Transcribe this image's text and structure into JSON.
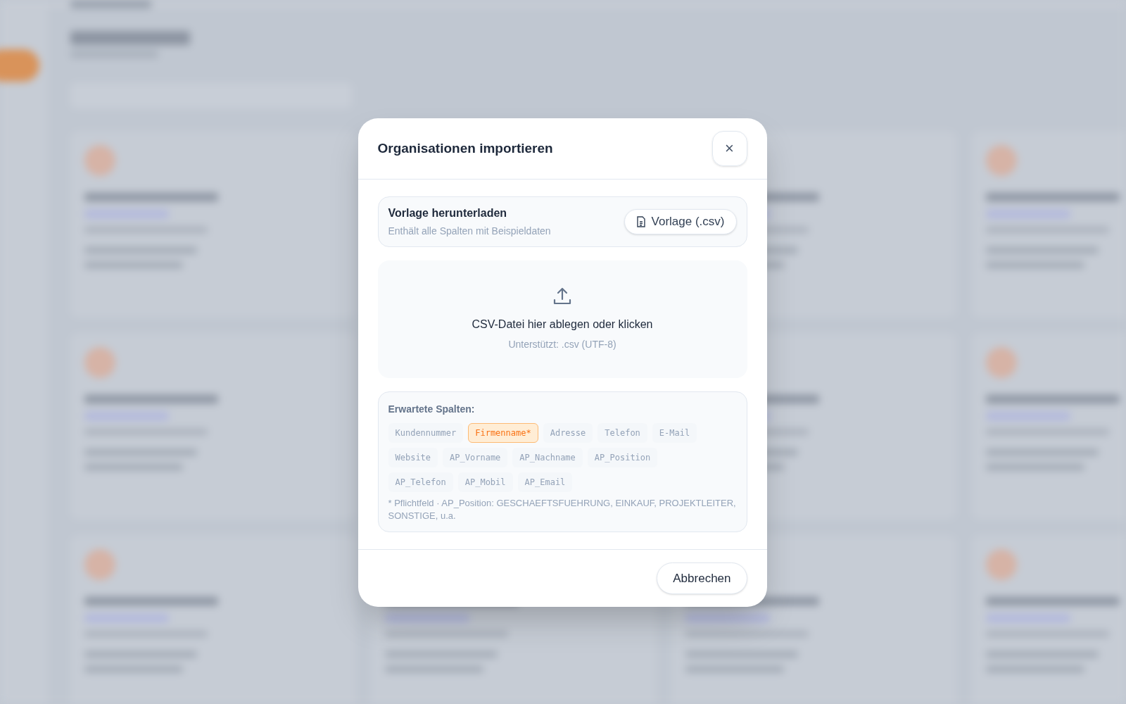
{
  "dialog": {
    "title": "Organisationen importieren",
    "close_label": "×",
    "template": {
      "title": "Vorlage herunterladen",
      "subtitle": "Enthält alle Spalten mit Beispieldaten",
      "button": "Vorlage (.csv)"
    },
    "dropzone": {
      "title": "CSV-Datei hier ablegen oder klicken",
      "hint": "Unterstützt: .csv (UTF-8)"
    },
    "columns": {
      "heading": "Erwartete Spalten:",
      "items": [
        {
          "label": "Kundennummer",
          "required": false
        },
        {
          "label": "Firmenname*",
          "required": true
        },
        {
          "label": "Adresse",
          "required": false
        },
        {
          "label": "Telefon",
          "required": false
        },
        {
          "label": "E-Mail",
          "required": false
        },
        {
          "label": "Website",
          "required": false
        },
        {
          "label": "AP_Vorname",
          "required": false
        },
        {
          "label": "AP_Nachname",
          "required": false
        },
        {
          "label": "AP_Position",
          "required": false
        },
        {
          "label": "AP_Telefon",
          "required": false
        },
        {
          "label": "AP_Mobil",
          "required": false
        },
        {
          "label": "AP_Email",
          "required": false
        }
      ],
      "note": "* Pflichtfeld · AP_Position: GESCHAEFTSFUEHRUNG, EINKAUF, PROJEKTLEITER, SONSTIGE, u.a."
    },
    "cancel": "Abbrechen"
  }
}
